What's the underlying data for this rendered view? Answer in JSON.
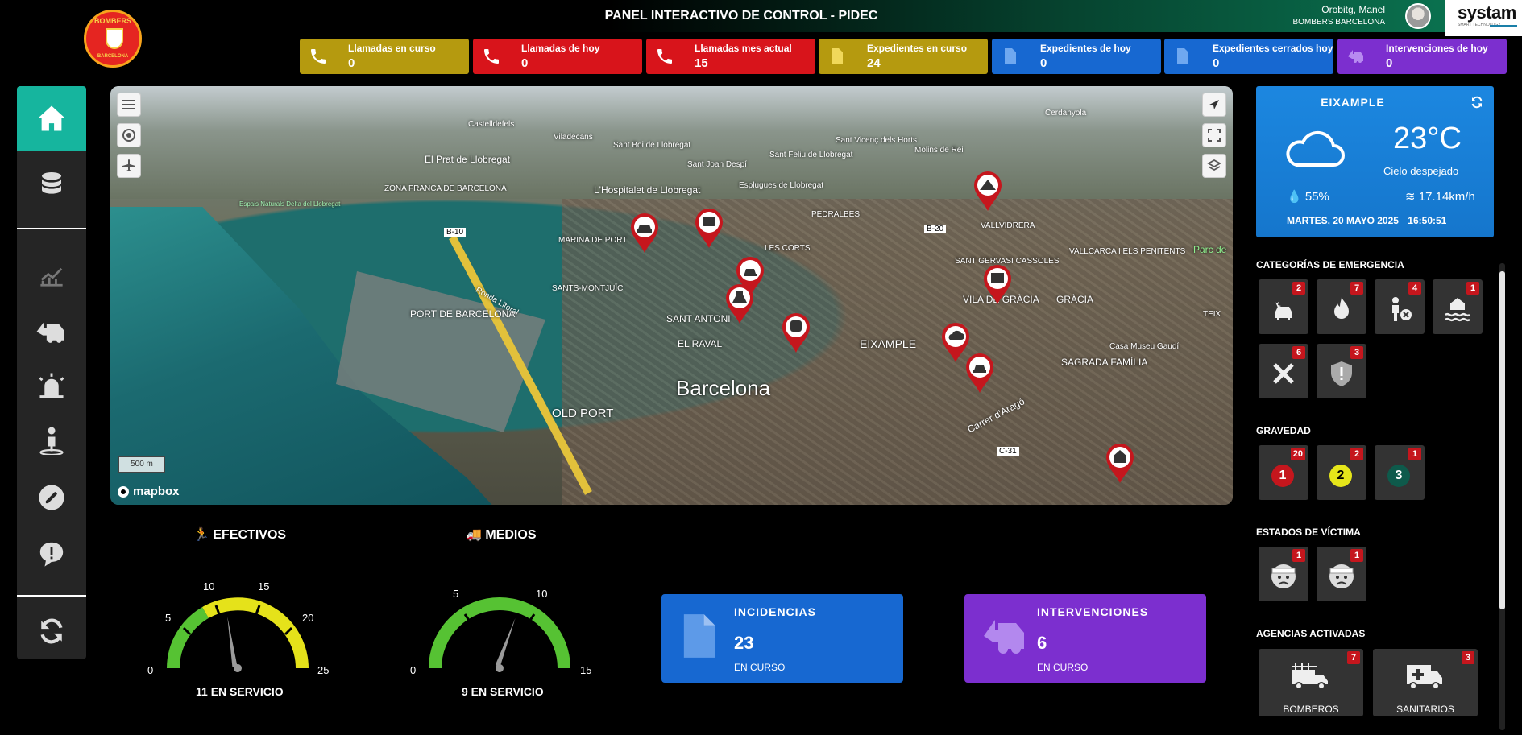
{
  "header": {
    "title": "PANEL INTERACTIVO DE CONTROL - PIDEC",
    "user_name": "Orobitg, Manel",
    "user_org": "BOMBERS BARCELONA",
    "brand_name": "systam",
    "brand_sub": "SMART TECHNOLOGY"
  },
  "logo": {
    "top_text": "BOMBERS",
    "bottom_text": "BARCELONA"
  },
  "stats": [
    {
      "label": "Llamadas en curso",
      "value": "0",
      "color": "#b59a0f",
      "icon": "phone-icon"
    },
    {
      "label": "Llamadas de hoy",
      "value": "0",
      "color": "#d8141b",
      "icon": "phone-icon"
    },
    {
      "label": "Llamadas mes actual",
      "value": "15",
      "color": "#d8141b",
      "icon": "phone-icon"
    },
    {
      "label": "Expedientes en curso",
      "value": "24",
      "color": "#b59a0f",
      "icon": "file-icon"
    },
    {
      "label": "Expedientes de hoy",
      "value": "0",
      "color": "#1768d1",
      "icon": "file-icon"
    },
    {
      "label": "Expedientes cerrados hoy",
      "value": "0",
      "color": "#1768d1",
      "icon": "file-icon"
    },
    {
      "label": "Intervenciones de hoy",
      "value": "0",
      "color": "#7c2fcf",
      "icon": "intervention-icon"
    }
  ],
  "sidebar": {
    "items": [
      {
        "icon": "home-icon",
        "active": true
      },
      {
        "icon": "database-icon"
      },
      {
        "icon": "chart-icon"
      },
      {
        "icon": "intervention-icon"
      },
      {
        "icon": "siren-icon"
      },
      {
        "icon": "person-location-icon"
      },
      {
        "icon": "edit-icon"
      },
      {
        "icon": "alert-icon"
      },
      {
        "icon": "refresh-icon"
      }
    ]
  },
  "map": {
    "labels": [
      "Barcelona",
      "OLD PORT",
      "EIXAMPLE",
      "EL RAVAL",
      "SANT ANTONI",
      "PORT DE BARCELONA",
      "SANTS-MONTJUÏC",
      "MARINA DE PORT",
      "L'Hospitalet de Llobregat",
      "El Prat de Llobregat",
      "ZONA FRANCA DE BARCELONA",
      "VILA DE GRÀCIA",
      "GRÀCIA",
      "SAGRADA FAMÍLIA",
      "VALLCARCA I ELS PENITENTS",
      "SANT GERVASI CASSOLES",
      "VALLVIDRERA",
      "Casa Museu Gaudí",
      "Carrer d'Aragó",
      "Sant Joan Despí",
      "Esplugues de Llobregat",
      "Viladecans",
      "Sant Boi de Llobregat",
      "Castelldefels",
      "PEDRALBES",
      "LES CORTS",
      "Molins de Rei",
      "Parc de",
      "Ronda Litoral",
      "Espais Naturals Delta del Llobregat",
      "Sant Feliu de Llobregat",
      "Sant Vicenç dels Horts",
      "Cerdanyola",
      "C-31",
      "B-10",
      "B-20",
      "TEIX"
    ],
    "scale": "500 m",
    "attribution": "mapbox"
  },
  "gauges": {
    "efectivos": {
      "title": "EFECTIVOS",
      "ticks": [
        "0",
        "5",
        "10",
        "15",
        "20",
        "25"
      ],
      "value": 11,
      "max": 25,
      "footer": "11 EN SERVICIO"
    },
    "medios": {
      "title": "MEDIOS",
      "ticks": [
        "0",
        "5",
        "10",
        "15"
      ],
      "value": 9,
      "max": 15,
      "footer": "9 EN SERVICIO"
    }
  },
  "summary": {
    "incidencias": {
      "title": "INCIDENCIAS",
      "value": "23",
      "sub": "EN CURSO",
      "color": "#1768d1"
    },
    "intervenciones": {
      "title": "INTERVENCIONES",
      "value": "6",
      "sub": "EN CURSO",
      "color": "#7c2fcf"
    }
  },
  "weather": {
    "city": "EIXAMPLE",
    "temp": "23°C",
    "desc": "Cielo despejado",
    "humidity": "55%",
    "wind": "17.14km/h",
    "date": "MARTES, 20 MAYO 2025",
    "time": "16:50:51"
  },
  "categories": {
    "title": "CATEGORÍAS DE EMERGENCIA",
    "items": [
      {
        "icon": "car-crash-icon",
        "count": "2"
      },
      {
        "icon": "fire-icon",
        "count": "7"
      },
      {
        "icon": "person-x-icon",
        "count": "4"
      },
      {
        "icon": "flood-icon",
        "count": "1"
      },
      {
        "icon": "tools-icon",
        "count": "6"
      },
      {
        "icon": "shield-alert-icon",
        "count": "3"
      }
    ]
  },
  "gravedad": {
    "title": "GRAVEDAD",
    "items": [
      {
        "level": "1",
        "count": "20",
        "color": "#c5161d"
      },
      {
        "level": "2",
        "count": "2",
        "color": "#e6e61a"
      },
      {
        "level": "3",
        "count": "1",
        "color": "#0e5a4b"
      }
    ]
  },
  "victimas": {
    "title": "ESTADOS DE VÍCTIMA",
    "items": [
      {
        "icon": "injured-face-icon",
        "count": "1"
      },
      {
        "icon": "injured-face-icon",
        "count": "1"
      }
    ]
  },
  "agencias": {
    "title": "AGENCIAS ACTIVADAS",
    "items": [
      {
        "name": "BOMBEROS",
        "count": "7",
        "icon": "fire-truck-icon"
      },
      {
        "name": "SANITARIOS",
        "count": "3",
        "icon": "ambulance-icon"
      }
    ]
  }
}
